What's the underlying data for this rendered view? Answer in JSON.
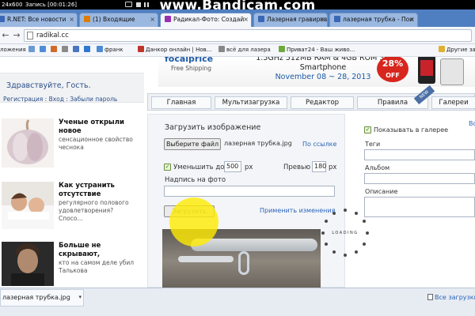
{
  "recorder": {
    "size": "24x600",
    "time": "Запись [00:01:26]"
  },
  "watermark": "www.Bandicam.com",
  "tabs": [
    {
      "label": "R.NET: Все новости",
      "favicon_color": "#3a67b5"
    },
    {
      "label": "(1) Входящие",
      "favicon_color": "#e07b00"
    },
    {
      "label": "Радикал-Фото: Создай",
      "favicon_color": "#9a2fb0"
    },
    {
      "label": "Лазерная гравировка",
      "favicon_color": "#3a67b5"
    },
    {
      "label": "лазерная трубка - Пои",
      "favicon_color": "#3a67b5"
    }
  ],
  "tab_close": "×",
  "address": {
    "back": "←",
    "forward": "→",
    "url": "radikal.cc"
  },
  "bookmarks": [
    {
      "label": "ложения",
      "color": "#4a76c0"
    },
    {
      "label": "",
      "color": "#6b9bd1"
    },
    {
      "label": "",
      "color": "#4f8cd6"
    },
    {
      "label": "",
      "color": "#d06a2a"
    },
    {
      "label": "",
      "color": "#8a8a8a"
    },
    {
      "label": "",
      "color": "#4a76c0"
    },
    {
      "label": "",
      "color": "#2e78d0"
    },
    {
      "label": "франк",
      "color": "#4a8cd6"
    },
    {
      "label": "Данкор онлайн | Нов...",
      "color": "#c0352b"
    },
    {
      "label": "всё для лазера",
      "color": "#888888"
    },
    {
      "label": "Приват24 - Ваш живо...",
      "color": "#6fa83b"
    },
    {
      "label": "Другие за",
      "color": "#e0b030"
    }
  ],
  "sidebar": {
    "greeting": "Здравствуйте, Гость.",
    "links": "Регистрация : Вход : Забыли пароль",
    "news": [
      {
        "title": "Ученые открыли новое",
        "desc": "сенсационное свойство чеснока"
      },
      {
        "title": "Как устранить отсутствие",
        "desc": "регулярного полового удовлетворения? Спосо..."
      },
      {
        "title": "Больше не скрывают,",
        "desc": "кто на самом деле убил Талькова"
      }
    ]
  },
  "banner": {
    "logo": "focalprice",
    "shipping": "Free Shipping",
    "spec": "1.5GHz 512MB RAM & 4GB ROM 3G Smartphone",
    "dates": "November 08 ~ 28, 2013",
    "discount_pct": "28%",
    "discount_label": "OFF"
  },
  "nav": {
    "items": [
      "Главная",
      "Мультизагрузка",
      "Редактор",
      "Правила",
      "Галереи"
    ],
    "new_badge": "NEW"
  },
  "upload": {
    "title": "Загрузить изображение",
    "choose_file": "Выберите файл",
    "file_name": "лазерная трубка.jpg",
    "by_link": "По ссылке",
    "reduce_label": "Уменьшить до",
    "reduce_value": "500",
    "reduce_unit": "px",
    "preview_label": "Превью",
    "preview_value": "180",
    "preview_unit": "px",
    "caption_label": "Надпись на фото",
    "caption_value": "",
    "upload_button": "Загрузить",
    "apply_changes": "Применить изменения",
    "check_mark": "✓"
  },
  "right": {
    "show_in_gallery": "Показывать в галерее",
    "tags_label": "Теги",
    "album_label": "Альбом",
    "description_label": "Описание",
    "partial_link": "Во"
  },
  "loading": "LOADING",
  "downloads": {
    "file": "лазерная трубка.jpg",
    "arrow": "▾",
    "all": "Все загрузки..."
  }
}
